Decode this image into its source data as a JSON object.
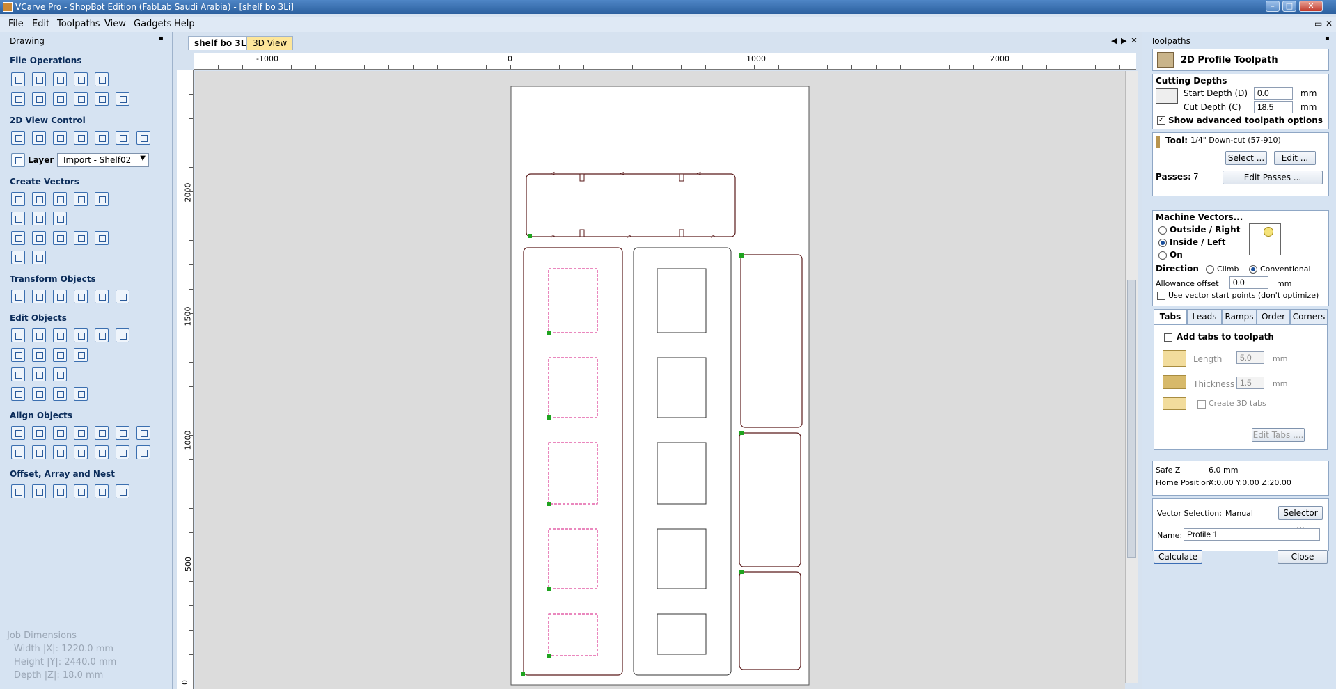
{
  "window": {
    "title": "VCarve Pro - ShopBot Edition (FabLab Saudi Arabia) - [shelf bo 3Li]",
    "minimize": "–",
    "maximize": "□",
    "close": "✕"
  },
  "menu": [
    "File",
    "Edit",
    "Toolpaths",
    "View",
    "Gadgets",
    "Help"
  ],
  "mdi_controls": [
    "–",
    "▭",
    "✕"
  ],
  "left_panel": {
    "title": "Drawing",
    "pin": "📌",
    "sections": {
      "file_operations": "File Operations",
      "view_control": "2D View Control",
      "create_vectors": "Create Vectors",
      "transform_objects": "Transform Objects",
      "edit_objects": "Edit Objects",
      "align_objects": "Align Objects",
      "offset_array_nest": "Offset, Array and Nest"
    },
    "layer_label": "Layer",
    "layer_value": "Import - Shelf02",
    "job_dimensions": {
      "title": "Job Dimensions",
      "width": "Width  |X|: 1220.0 mm",
      "height": "Height |Y|: 2440.0 mm",
      "depth": "Depth  |Z|: 18.0 mm"
    }
  },
  "tabs": [
    "shelf bo 3Li",
    "3D View"
  ],
  "ruler_top": [
    "-1000",
    "0",
    "1000",
    "2000"
  ],
  "ruler_left": [
    "2000",
    "1500",
    "1000",
    "500",
    "0"
  ],
  "right_panel": {
    "title": "Toolpaths",
    "tool_title": "2D Profile Toolpath",
    "cutting_depths": "Cutting Depths",
    "start_depth_label": "Start Depth (D)",
    "start_depth": "0.0",
    "cut_depth_label": "Cut Depth (C)",
    "cut_depth": "18.5",
    "unit": "mm",
    "show_advanced": "Show advanced toolpath options",
    "tool_label": "Tool:",
    "tool_value": "1/4\"  Down-cut (57-910)",
    "select_btn": "Select ...",
    "edit_btn": "Edit ...",
    "passes_label": "Passes:",
    "passes_value": "7",
    "edit_passes_btn": "Edit Passes ...",
    "machine_vectors": "Machine Vectors...",
    "outside_right": "Outside / Right",
    "inside_left": "Inside / Left",
    "on": "On",
    "direction": "Direction",
    "climb": "Climb",
    "conventional": "Conventional",
    "allowance_label": "Allowance offset",
    "allowance_value": "0.0",
    "use_vector_start": "Use vector start points (don't optimize)",
    "subtabs": [
      "Tabs",
      "Leads",
      "Ramps",
      "Order",
      "Corners"
    ],
    "add_tabs": "Add tabs to toolpath",
    "length_label": "Length",
    "length_value": "5.0",
    "thickness_label": "Thickness",
    "thickness_value": "1.5",
    "create_3d_tabs": "Create 3D tabs",
    "edit_tabs_btn": "Edit Tabs ....",
    "safe_z_label": "Safe Z",
    "safe_z_value": "6.0 mm",
    "home_label": "Home Position",
    "home_value": "X:0.00 Y:0.00 Z:20.00",
    "vector_selection_label": "Vector Selection:",
    "vector_selection_value": "Manual",
    "selector_btn": "Selector ...",
    "name_label": "Name:",
    "name_value": "Profile 1",
    "calculate_btn": "Calculate",
    "close_btn": "Close"
  },
  "colors": {
    "accent": "#2b5f9e",
    "vector_outline": "#5a1a1a",
    "selected_dashed": "#d4117e",
    "start_point": "#1fa31f"
  }
}
